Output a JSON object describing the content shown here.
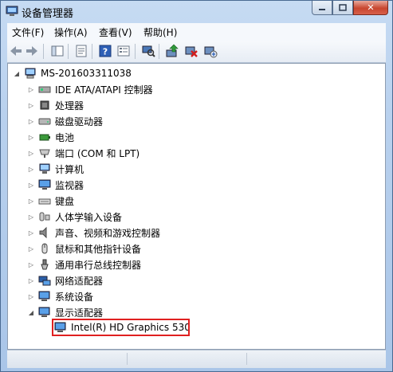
{
  "window": {
    "title": "设备管理器"
  },
  "menu": {
    "items": [
      "文件(F)",
      "操作(A)",
      "查看(V)",
      "帮助(H)"
    ]
  },
  "tree": {
    "root": "MS-201603311038",
    "categories": [
      "IDE ATA/ATAPI 控制器",
      "处理器",
      "磁盘驱动器",
      "电池",
      "端口 (COM 和 LPT)",
      "计算机",
      "监视器",
      "键盘",
      "人体学输入设备",
      "声音、视频和游戏控制器",
      "鼠标和其他指针设备",
      "通用串行总线控制器",
      "网络适配器",
      "系统设备",
      "显示适配器"
    ],
    "selected_device": "Intel(R) HD Graphics 530"
  },
  "highlight_color": "#e02020",
  "icons": [
    "device-manager-icon",
    "back-icon",
    "forward-icon",
    "properties-icon",
    "update-icon",
    "help-icon",
    "view-icon",
    "scan-hardware-icon",
    "update-driver-icon",
    "disable-icon",
    "uninstall-icon"
  ]
}
